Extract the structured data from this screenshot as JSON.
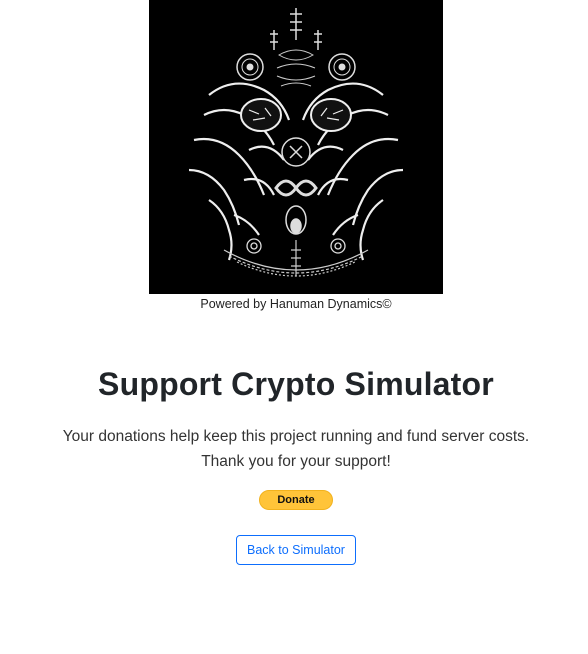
{
  "logo": {
    "description_icon": "tiger-yantra-logo",
    "background": "#000000"
  },
  "caption": "Powered by Hanuman Dynamics©",
  "heading": "Support Crypto Simulator",
  "description": {
    "line1": "Your donations help keep this project running and fund server costs.",
    "line2": "Thank you for your support!"
  },
  "buttons": {
    "donate_label": "Donate",
    "back_label": "Back to Simulator"
  },
  "colors": {
    "donate_bg": "#ffc439",
    "link_blue": "#0d6efd"
  }
}
